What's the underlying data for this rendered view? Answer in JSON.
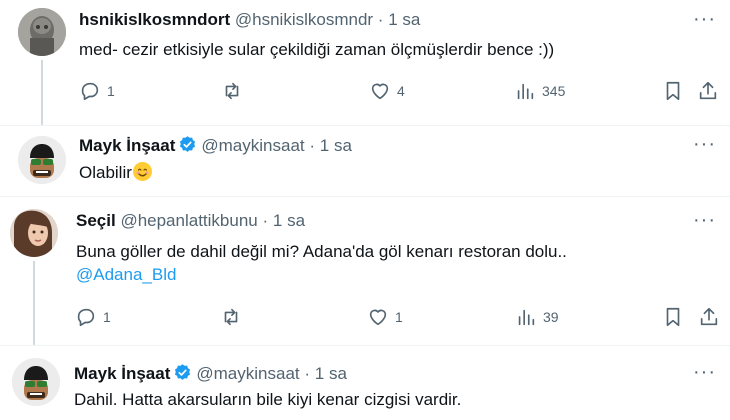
{
  "tweets": [
    {
      "name": "hsnikislkosmndort",
      "handle": "@hsnikislkosmndr",
      "time": "1 sa",
      "text": "med- cezir etkisiyle sular çekildiği zaman ölçmüşlerdir bence :))",
      "replies": "1",
      "retweets": "",
      "likes": "4",
      "views": "345"
    },
    {
      "name": "Mayk İnşaat",
      "handle": "@maykinsaat",
      "time": "1 sa",
      "text": "Olabilir"
    },
    {
      "name": "Seçil",
      "handle": "@hepanlattikbunu",
      "time": "1 sa",
      "text": "Buna göller de dahil değil mi? Adana'da göl kenarı restoran dolu..",
      "mention": "@Adana_Bld",
      "replies": "1",
      "retweets": "",
      "likes": "1",
      "views": "39"
    },
    {
      "name": "Mayk İnşaat",
      "handle": "@maykinsaat",
      "time": "1 sa",
      "text": "Dahil. Hatta akarsuların bile kiyi kenar cizgisi vardir."
    }
  ],
  "separator": "·",
  "more_label": "···",
  "colors": {
    "accent": "#1d9bf0",
    "muted": "#536471",
    "text": "#0f1419",
    "line": "#cfd9de"
  }
}
